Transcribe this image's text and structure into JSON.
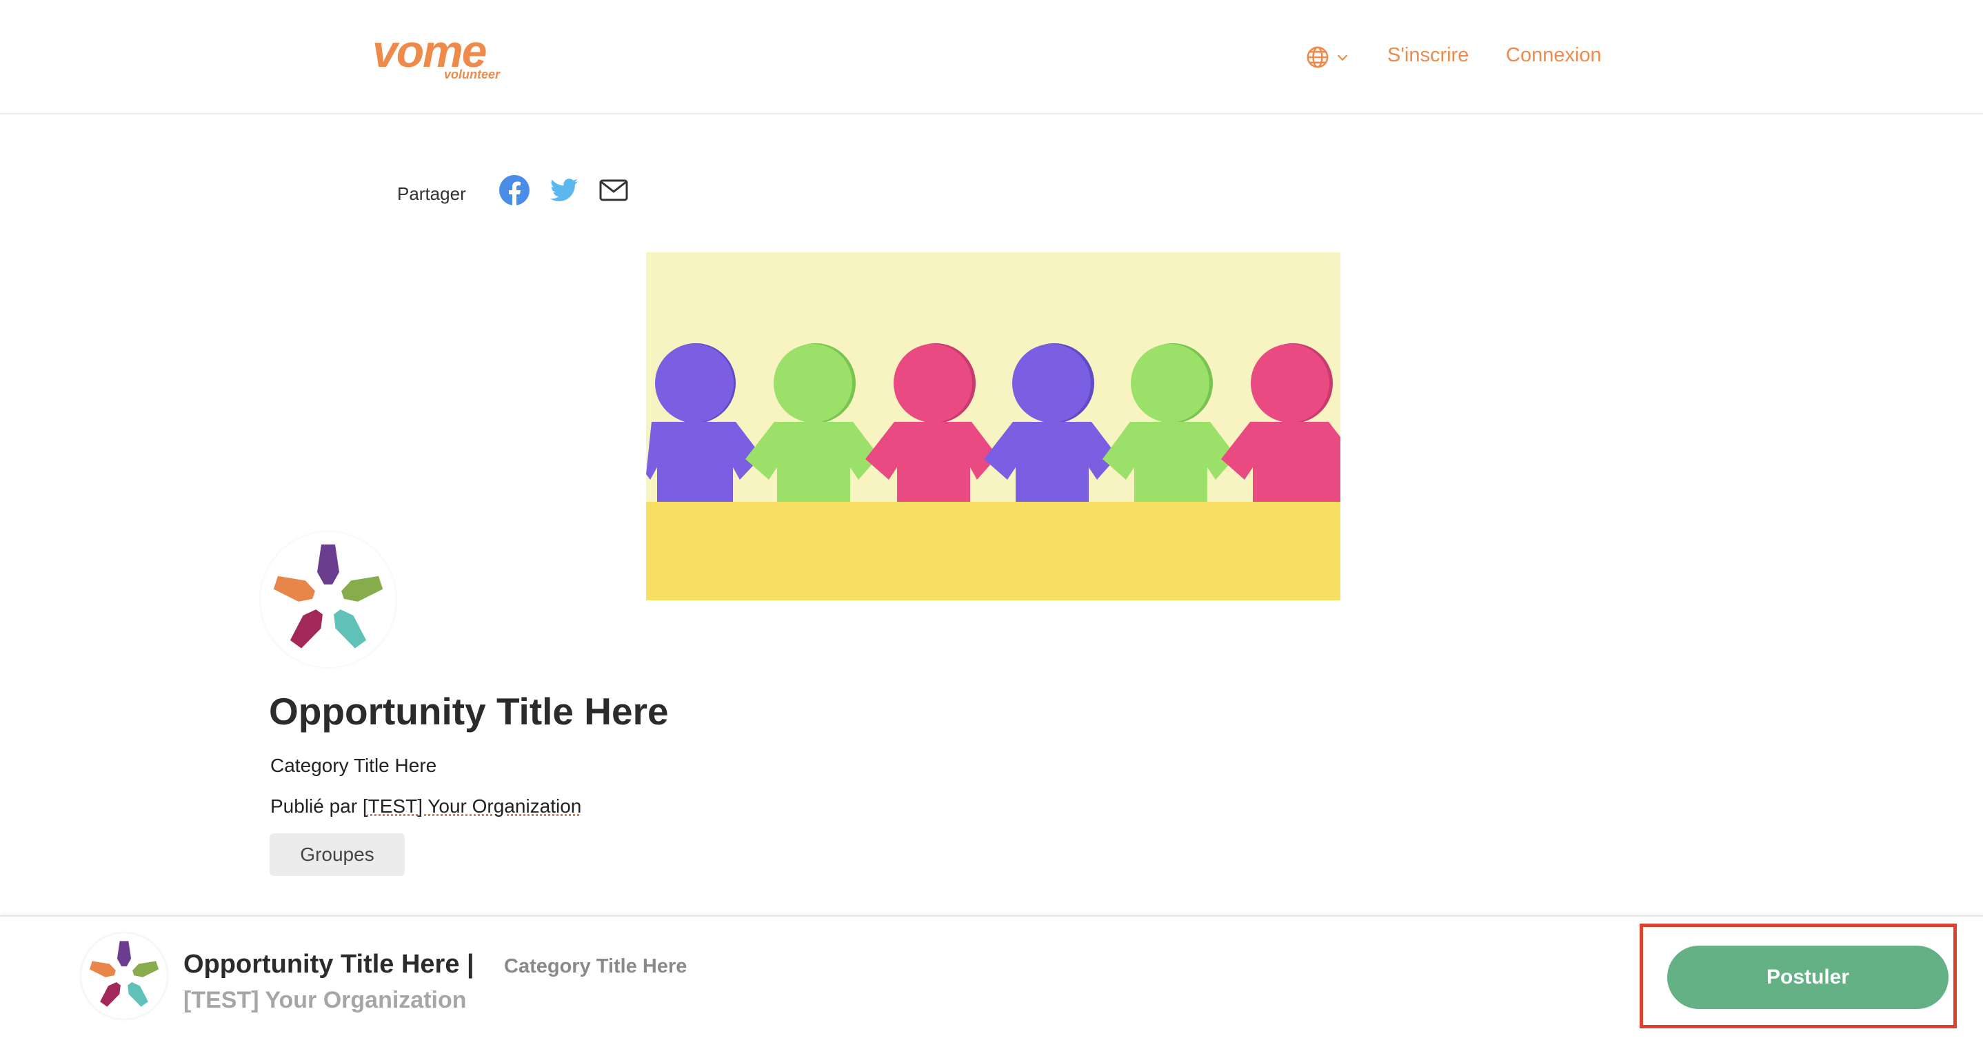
{
  "header": {
    "logo_main": "vome",
    "logo_sub": "volunteer",
    "language_icon": "globe-icon",
    "signup_label": "S'inscrire",
    "login_label": "Connexion"
  },
  "share": {
    "label": "Partager",
    "icons": [
      "facebook-icon",
      "twitter-icon",
      "mail-icon"
    ]
  },
  "opportunity": {
    "title": "Opportunity Title Here",
    "category": "Category Title Here",
    "published_prefix": "Publié par",
    "organization": "[TEST] Your Organization",
    "tag": "Groupes"
  },
  "footer": {
    "title": "Opportunity Title Here |",
    "category": "Category Title Here",
    "organization": "[TEST] Your Organization",
    "apply_label": "Postuler"
  },
  "colors": {
    "brand": "#ee8a4a",
    "apply_button": "#64b185",
    "highlight": "#d9442f",
    "facebook": "#4a8de8",
    "twitter": "#5cb7ee"
  }
}
